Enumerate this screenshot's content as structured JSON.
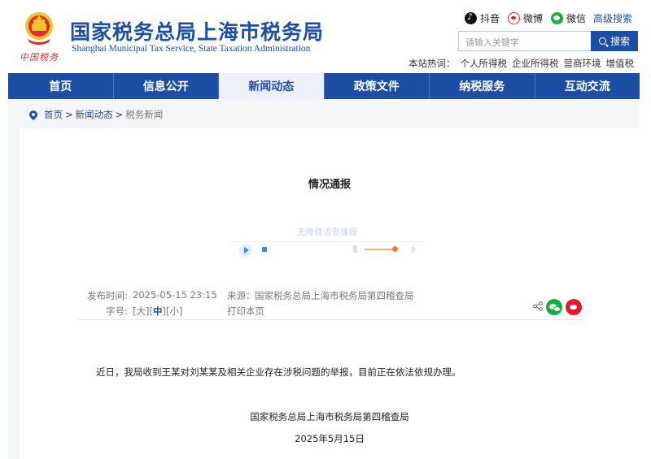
{
  "header": {
    "title": "国家税务总局上海市税务局",
    "subtitle": "Shanghai Municipal Tax Service, State Taxation Administration",
    "social": [
      {
        "label": "抖音",
        "icon": "douyin-icon"
      },
      {
        "label": "微博",
        "icon": "weibo-icon"
      },
      {
        "label": "微信",
        "icon": "wechat-icon"
      }
    ],
    "advanced_search": "高级搜索",
    "search": {
      "placeholder": "请输入关键字",
      "button_label": "搜索"
    },
    "hot_words_label": "本站热词：",
    "hot_words": [
      "个人所得税",
      "企业所得税",
      "营商环境",
      "增值税"
    ]
  },
  "nav": {
    "items": [
      "首页",
      "信息公开",
      "新闻动态",
      "政策文件",
      "纳税服务",
      "互动交流"
    ],
    "active_index": 2
  },
  "breadcrumb": {
    "items": [
      "首页",
      "新闻动态",
      "税务新闻"
    ],
    "separator": ">"
  },
  "article": {
    "title": "情况通报",
    "audio_label": "无障碍语音播报",
    "publish_time_label": "发布时间:",
    "publish_time": "2025-05-15 23:15",
    "source_label": "来源：",
    "source": "国家税务总局上海市税务局第四稽查局",
    "font_size_label": "字号:",
    "font_sizes": [
      "大",
      "中",
      "小"
    ],
    "font_size_active": "中",
    "print_label": "打印本页",
    "body": "近日，我局收到王某对刘某某及相关企业存在涉税问题的举报，目前正在依法依规办理。",
    "signature": "国家税务总局上海市税务局第四稽查局",
    "date": "2025年5月15日"
  },
  "colors": {
    "brand_blue": "#1c4fa3",
    "wechat_green": "#16b042",
    "weibo_red": "#e6162d"
  }
}
